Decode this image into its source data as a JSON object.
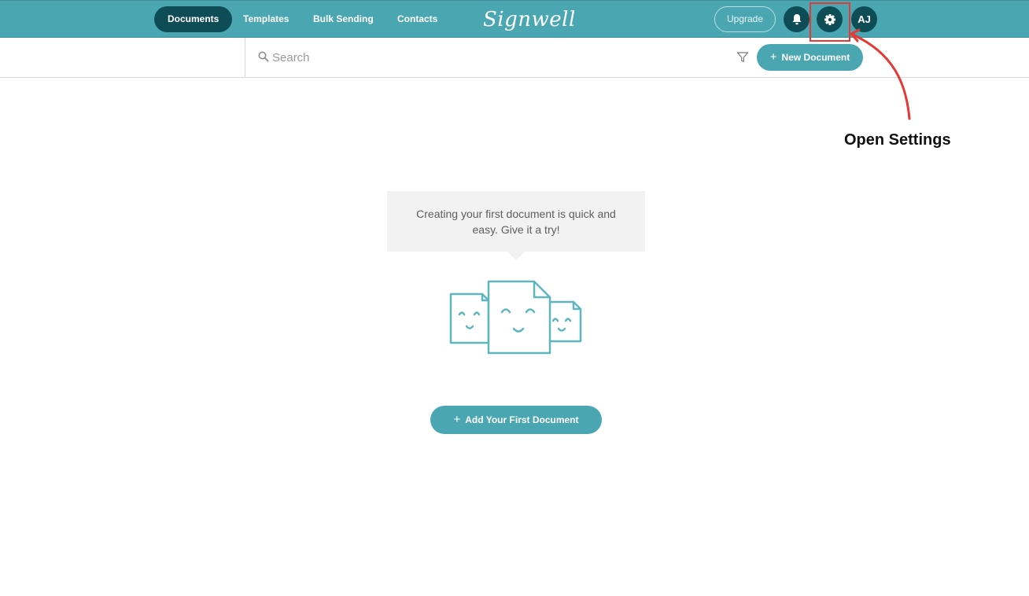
{
  "nav": {
    "tabs": [
      {
        "label": "Documents",
        "active": true
      },
      {
        "label": "Templates",
        "active": false
      },
      {
        "label": "Bulk Sending",
        "active": false
      },
      {
        "label": "Contacts",
        "active": false
      }
    ],
    "logo": "Signwell",
    "upgrade_label": "Upgrade",
    "avatar_initials": "AJ",
    "icons": {
      "notifications": "bell-icon",
      "settings": "gear-icon"
    }
  },
  "toolbar": {
    "search_placeholder": "Search",
    "new_document_label": "New Document",
    "icons": {
      "search": "search-icon",
      "filter": "filter-icon",
      "plus": "plus-icon"
    }
  },
  "annotation": {
    "label": "Open Settings",
    "color": "#e53935"
  },
  "empty_state": {
    "message": "Creating your first document is quick and easy. Give it a try!",
    "button_label": "Add Your First Document",
    "illustration": "smiling-documents-illustration"
  },
  "colors": {
    "brand": "#4aa7b1",
    "active_tab": "#0e4d55",
    "annotation": "#e53935"
  }
}
